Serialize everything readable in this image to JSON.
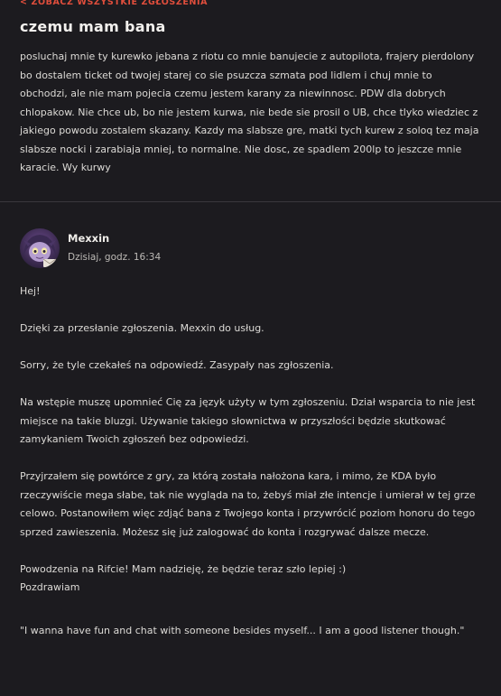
{
  "back_link": "< ZOBACZ WSZYSTKIE ZGŁOSZENIA",
  "ticket": {
    "title": "czemu mam bana",
    "body": "posluchaj mnie ty kurewko jebana z riotu co mnie banujecie z autopilota, frajery pierdolony bo dostalem ticket od twojej starej co sie psuzcza szmata pod lidlem i chuj mnie to obchodzi, ale nie mam pojecia czemu jestem karany za niewinnosc. PDW dla dobrych chlopakow. Nie chce ub, bo nie jestem kurwa, nie bede sie prosil o UB, chce tlyko wiedziec z jakiego powodu zostalem skazany. Kazdy ma slabsze gre, matki tych kurew z soloq tez maja slabsze nocki i zarabiaja mniej, to normalne. Nie dosc, ze spadlem 200lp to jeszcze mnie karacie. Wy kurwy"
  },
  "reply": {
    "author": "Mexxin",
    "timestamp": "Dzisiaj, godz. 16:34",
    "paragraphs": [
      "Hej!",
      "Dzięki za przesłanie zgłoszenia. Mexxin do usług.",
      "Sorry, że tyle czekałeś na odpowiedź. Zasypały nas zgłoszenia.",
      "Na wstępie muszę upomnieć Cię za język użyty w tym zgłoszeniu. Dział wsparcia to nie jest miejsce na takie bluzgi. Używanie takiego słownictwa w przyszłości będzie skutkować zamykaniem Twoich zgłoszeń bez odpowiedzi.",
      "Przyjrzałem się powtórce z gry, za którą została nałożona kara, i mimo, że KDA było rzeczywiście mega słabe, tak nie wygląda na to, żebyś miał złe intencje i umierał w tej grze celowo. Postanowiłem więc zdjąć bana z Twojego konta i przywrócić poziom honoru do tego sprzed zawieszenia. Możesz się już zalogować do konta i rozgrywać dalsze mecze.",
      "Powodzenia na Rifcie! Mam nadzieję, że będzie teraz szło lepiej :)\nPozdrawiam",
      "\"I wanna have fun and chat with someone besides myself... I am a good listener though.\""
    ]
  },
  "colors": {
    "background": "#1c1b1f",
    "accent": "#e04e3c",
    "divider": "#3a383d"
  },
  "icons": {
    "avatar": "agent-avatar-portrait"
  }
}
